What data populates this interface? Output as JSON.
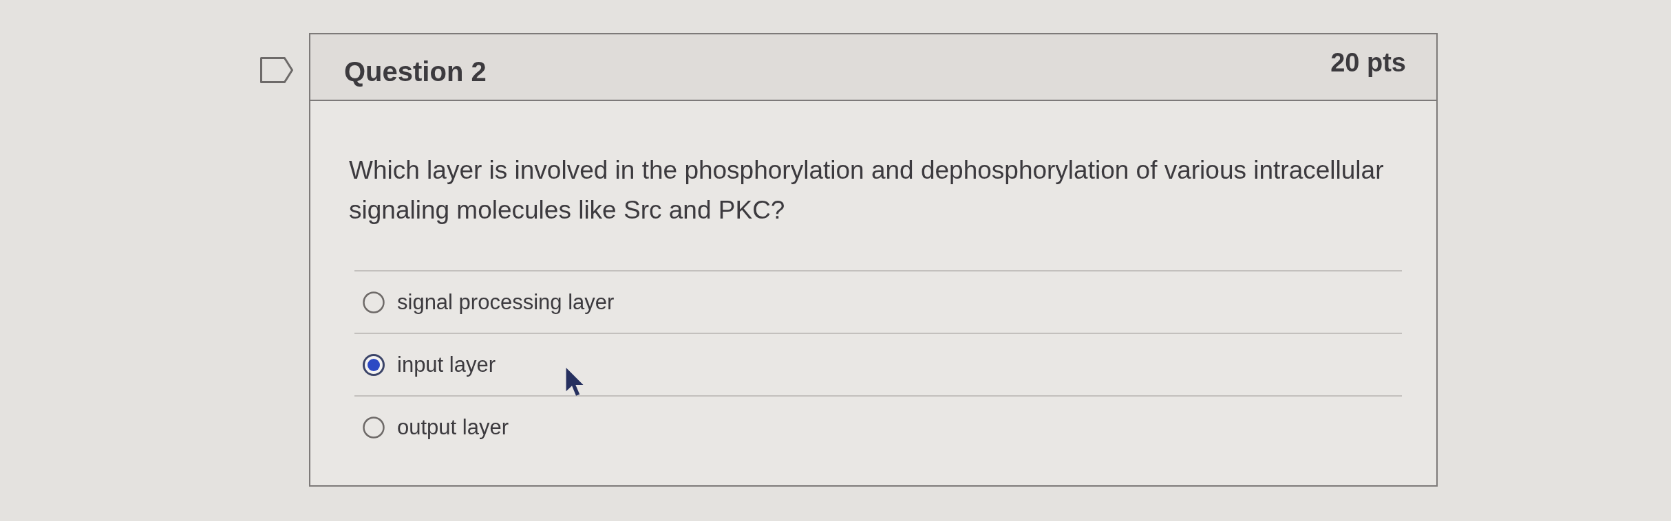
{
  "question": {
    "flagged": false,
    "title": "Question 2",
    "points": "20 pts",
    "text": "Which layer is involved in the phosphorylation and dephosphorylation of various intracellular signaling molecules like Src and PKC?",
    "answers": [
      {
        "label": "signal processing layer",
        "selected": false
      },
      {
        "label": "input layer",
        "selected": true
      },
      {
        "label": "output layer",
        "selected": false
      }
    ]
  }
}
